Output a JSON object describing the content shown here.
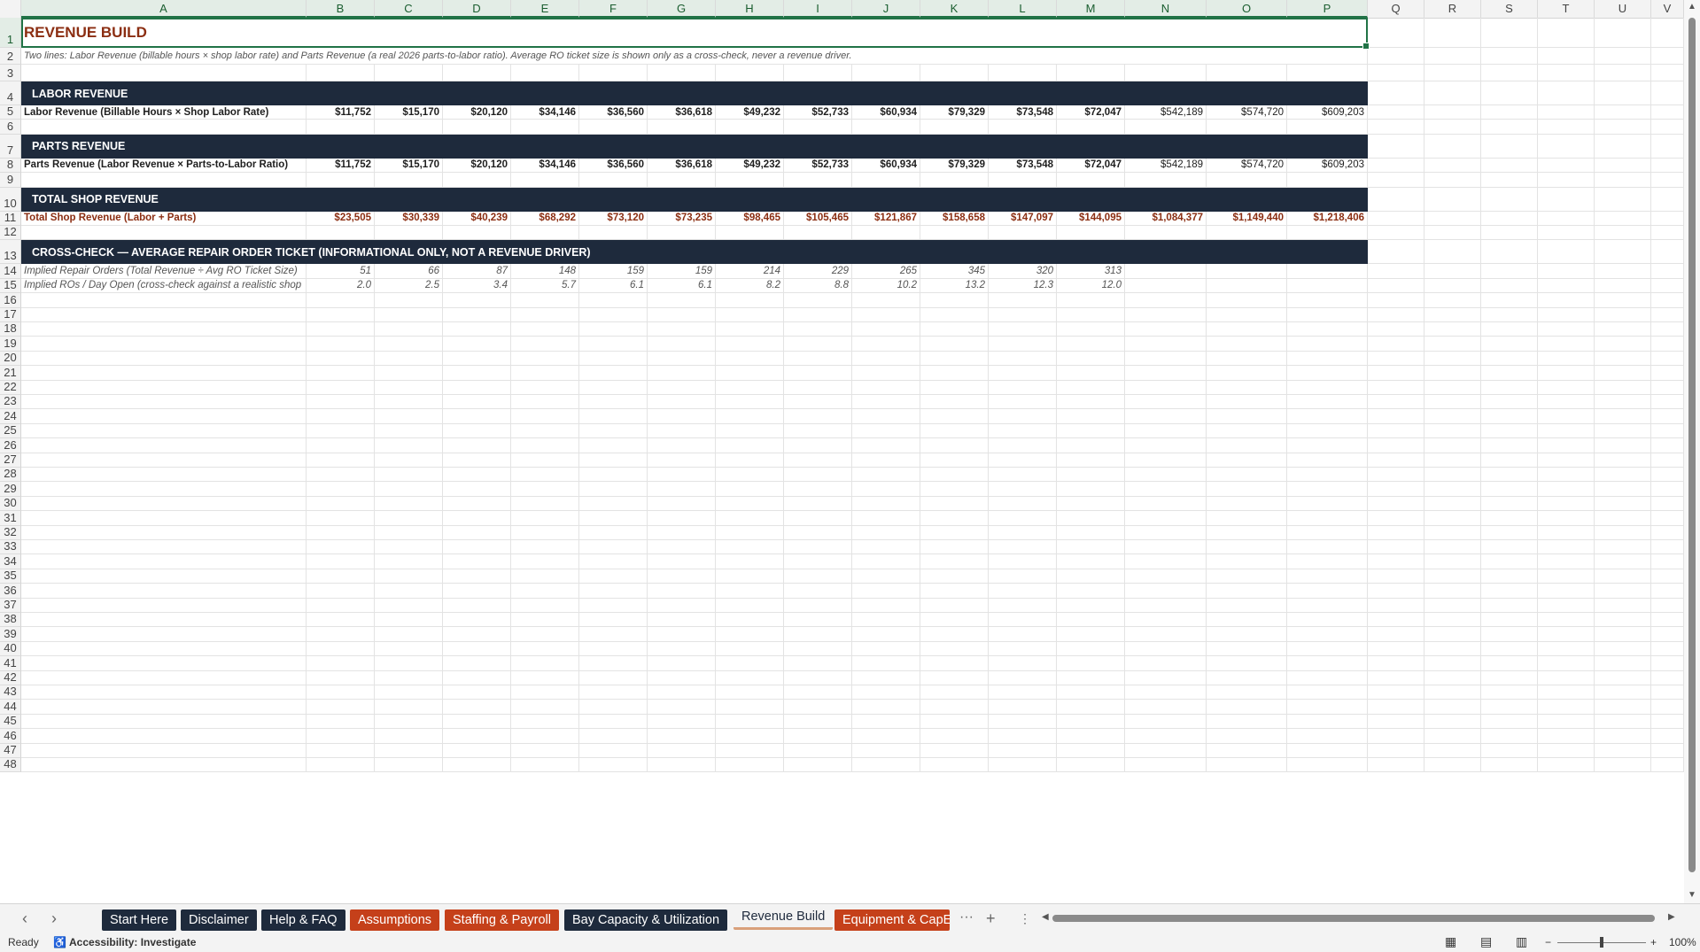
{
  "columns": [
    "A",
    "B",
    "C",
    "D",
    "E",
    "F",
    "G",
    "H",
    "I",
    "J",
    "K",
    "L",
    "M",
    "N",
    "O",
    "P",
    "Q",
    "R",
    "S",
    "T",
    "U",
    "V"
  ],
  "sheet": {
    "title": "REVENUE BUILD",
    "subtitle": "Two lines: Labor Revenue (billable hours × shop labor rate) and Parts Revenue (a real 2026 parts-to-labor ratio). Average RO ticket size is shown only as a cross-check, never a revenue driver.",
    "sections": {
      "labor": "LABOR REVENUE",
      "parts": "PARTS REVENUE",
      "total": "TOTAL SHOP REVENUE",
      "crosscheck": "CROSS-CHECK — AVERAGE REPAIR ORDER TICKET (INFORMATIONAL ONLY, NOT A REVENUE DRIVER)"
    },
    "labor_row": {
      "label": "Labor Revenue (Billable Hours × Shop Labor Rate)",
      "values": [
        "$11,752",
        "$15,170",
        "$20,120",
        "$34,146",
        "$36,560",
        "$36,618",
        "$49,232",
        "$52,733",
        "$60,934",
        "$79,329",
        "$73,548",
        "$72,047",
        "$542,189",
        "$574,720",
        "$609,203"
      ]
    },
    "parts_row": {
      "label": "Parts Revenue (Labor Revenue × Parts-to-Labor Ratio)",
      "values": [
        "$11,752",
        "$15,170",
        "$20,120",
        "$34,146",
        "$36,560",
        "$36,618",
        "$49,232",
        "$52,733",
        "$60,934",
        "$79,329",
        "$73,548",
        "$72,047",
        "$542,189",
        "$574,720",
        "$609,203"
      ]
    },
    "total_row": {
      "label": "Total Shop Revenue (Labor + Parts)",
      "values": [
        "$23,505",
        "$30,339",
        "$40,239",
        "$68,292",
        "$73,120",
        "$73,235",
        "$98,465",
        "$105,465",
        "$121,867",
        "$158,658",
        "$147,097",
        "$144,095",
        "$1,084,377",
        "$1,149,440",
        "$1,218,406"
      ]
    },
    "implied_ro_row": {
      "label": "Implied Repair Orders (Total Revenue ÷ Avg RO Ticket Size)",
      "values": [
        "51",
        "66",
        "87",
        "148",
        "159",
        "159",
        "214",
        "229",
        "265",
        "345",
        "320",
        "313"
      ]
    },
    "implied_day_row": {
      "label": "Implied ROs / Day Open (cross-check against a realistic shop",
      "values": [
        "2.0",
        "2.5",
        "3.4",
        "5.7",
        "6.1",
        "6.1",
        "8.2",
        "8.8",
        "10.2",
        "13.2",
        "12.3",
        "12.0"
      ]
    }
  },
  "tabs": [
    {
      "label": "Start Here",
      "style": "dark"
    },
    {
      "label": "Disclaimer",
      "style": "dark"
    },
    {
      "label": "Help & FAQ",
      "style": "dark"
    },
    {
      "label": "Assumptions",
      "style": "orange"
    },
    {
      "label": "Staffing & Payroll",
      "style": "orange"
    },
    {
      "label": "Bay Capacity & Utilization",
      "style": "dark"
    },
    {
      "label": "Revenue Build",
      "style": "active"
    },
    {
      "label": "Equipment & CapEx",
      "style": "orange"
    }
  ],
  "tab_more": "···",
  "tab_add": "+",
  "status": {
    "ready": "Ready",
    "accessibility": "Accessibility: Investigate",
    "zoom": "100%"
  },
  "colors": {
    "band": "#1e2a3c",
    "accent": "#c5401a",
    "total_text": "#8b2e12",
    "selection": "#217346"
  }
}
